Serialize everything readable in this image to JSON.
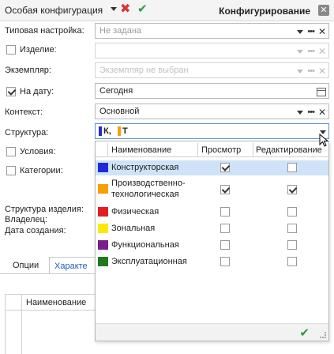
{
  "titlebar": {
    "title": "Особая конфигурация",
    "right_title": "Конфигурирование",
    "close_glyph": "✕",
    "cancel_glyph": "✖",
    "apply_glyph": "✔"
  },
  "form": {
    "typical": {
      "label": "Типовая настройка:",
      "value": "Не задана"
    },
    "product": {
      "label": "Изделие:",
      "checked": false
    },
    "instance": {
      "label": "Экземпляр:",
      "placeholder": "Экземпляр не выбран"
    },
    "on_date": {
      "label": "На дату:",
      "checked": true,
      "value": "Сегодня"
    },
    "context": {
      "label": "Контекст:",
      "value": "Основной"
    },
    "structure": {
      "label": "Структура:",
      "tags": [
        {
          "text": "К,",
          "color": "#1f2bd6"
        },
        {
          "text": "Т",
          "color": "#f5a100"
        }
      ]
    },
    "conditions": {
      "label": "Условия:",
      "checked": false
    },
    "categories": {
      "label": "Категории:",
      "checked": false
    }
  },
  "info": {
    "structure_label": "Структура изделия:",
    "owner_label": "Владелец:",
    "created_label": "Дата создания:"
  },
  "tabs": [
    {
      "label": "Опции",
      "active": false
    },
    {
      "label": "Характе",
      "active": true
    }
  ],
  "grid": {
    "column": "Наименование"
  },
  "popup": {
    "columns": {
      "name": "Наименование",
      "view": "Просмотр",
      "edit": "Редактирование"
    },
    "rows": [
      {
        "name": "Конструкторская",
        "color": "#1f2bd6",
        "view": true,
        "edit": false,
        "selected": true
      },
      {
        "name_line1": "Производственно-",
        "name_line2": "технологическая",
        "color": "#f5a100",
        "view": true,
        "edit": true,
        "selected": false
      },
      {
        "name": "Физическая",
        "color": "#e02020",
        "view": false,
        "edit": false,
        "selected": false
      },
      {
        "name": "Зональная",
        "color": "#ffe800",
        "view": false,
        "edit": false,
        "selected": false
      },
      {
        "name": "Функциональная",
        "color": "#7a1f8a",
        "view": false,
        "edit": false,
        "selected": false
      },
      {
        "name": "Эксплуатационная",
        "color": "#1e7a1e",
        "view": false,
        "edit": false,
        "selected": false
      }
    ],
    "ok_glyph": "✔"
  }
}
